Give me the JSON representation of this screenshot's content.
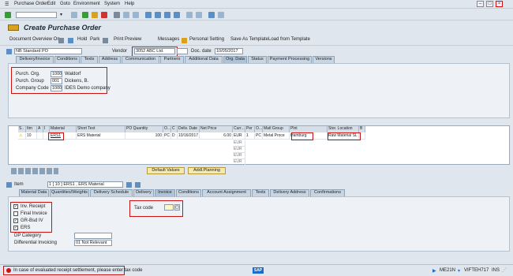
{
  "menu": {
    "items": [
      "Purchase Order",
      "Edit",
      "Goto",
      "Environment",
      "System",
      "Help"
    ]
  },
  "title": "Create Purchase Order",
  "app_toolbar": {
    "doc_overview": "Document Overview On",
    "hold": "Hold",
    "park": "Park",
    "print_preview": "Print Preview",
    "messages": "Messages",
    "personal_setting": "Personal Setting",
    "save_as_template": "Save As Template",
    "load_from_template": "Load from Template"
  },
  "header": {
    "doc_type": "NB Standard PO",
    "vendor_label": "Vendor",
    "vendor_value": "3052 ABC Ltd.",
    "doc_date_label": "Doc. date",
    "doc_date_value": "10/05/2017"
  },
  "header_tabs": [
    "Delivery/Invoice",
    "Conditions",
    "Texts",
    "Address",
    "Communication",
    "Partners",
    "Additional Data",
    "Org. Data",
    "Status",
    "Payment Processing",
    "Versions"
  ],
  "org_data": {
    "purch_org_label": "Purch. Org.",
    "purch_org_code": "1000",
    "purch_org_name": "Waldorf",
    "purch_group_label": "Purch. Group",
    "purch_group_code": "001",
    "purch_group_name": "Dickens, B.",
    "company_code_label": "Company Code",
    "company_code_code": "1000",
    "company_code_name": "IDES Demo company"
  },
  "item_table": {
    "headers": [
      "S..",
      "Itm",
      "A",
      "I",
      "Material",
      "Short Text",
      "PO Quantity",
      "O...",
      "C",
      "Deliv. Date",
      "Net Price",
      "Curr...",
      "Per",
      "O...",
      "Matl Group",
      "Plnt",
      "Stor. Location",
      "B"
    ],
    "row1": {
      "itm": "10",
      "material": "ERS1",
      "short_text": "ERS Material",
      "qty": "100",
      "unit": "PC",
      "c": "D",
      "deliv": "10/16/2017",
      "price": "6.00",
      "curr": "EUR",
      "per": "1",
      "o": "PC",
      "matl_group": "Metal Proce",
      "plant": "Hamburg",
      "stor": "Raw Material SL"
    },
    "empty_curr": [
      "EUR",
      "EUR",
      "EUR",
      "EUR"
    ]
  },
  "grid_buttons": {
    "default_values": "Default Values",
    "addl_planning": "Addl.Planning"
  },
  "item_detail": {
    "item_label": "Item",
    "item_value": "1 [ 10 ] ERS1 , ERS Material"
  },
  "item_tabs": [
    "Material Data",
    "Quantities/Weights",
    "Delivery Schedule",
    "Delivery",
    "Invoice",
    "Conditions",
    "Account Assignment",
    "Texts",
    "Delivery Address",
    "Confirmations"
  ],
  "invoice": {
    "inv_receipt": "Inv. Receipt",
    "final_invoice": "Final Invoice",
    "gr_bsd_iv": "GR-Bsd IV",
    "ers": "ERS",
    "dp_category": "DP Category",
    "diff_invoicing": "Differential Invoicing",
    "diff_invoicing_value": "01 Not Relevant",
    "tax_code_label": "Tax code"
  },
  "status": {
    "message": "In case of evaluated receipt settlement, please enter tax code",
    "sap": "SAP",
    "transaction": "ME21N",
    "server": "VIFTEH717",
    "mode": "INS"
  },
  "colors": {
    "highlight": "#cc1111",
    "sap_blue": "#1a6cc8"
  }
}
